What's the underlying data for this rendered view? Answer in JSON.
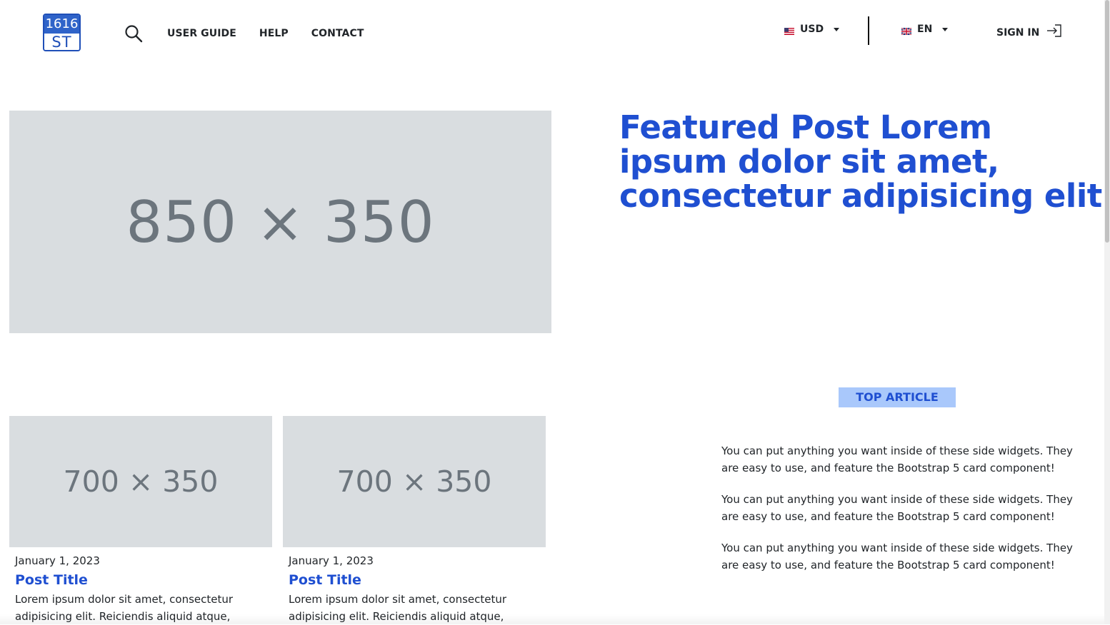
{
  "header": {
    "logo": {
      "top": "1616",
      "bottom": "ST"
    },
    "nav": [
      {
        "label": "USER GUIDE"
      },
      {
        "label": "HELP"
      },
      {
        "label": "CONTACT"
      }
    ],
    "currency": {
      "label": "USD",
      "flag": "us-flag"
    },
    "language": {
      "label": "EN",
      "flag": "uk-flag"
    },
    "signin": {
      "label": "SIGN IN"
    }
  },
  "featured": {
    "image_label": "850 × 350",
    "title": "Featured Post Lorem ipsum dolor sit amet, consectetur adipisicing elit"
  },
  "posts": [
    {
      "image_label": "700 × 350",
      "date": "January 1, 2023",
      "title": "Post Title",
      "excerpt": "Lorem ipsum dolor sit amet, consectetur adipisicing elit. Reiciendis aliquid atque,"
    },
    {
      "image_label": "700 × 350",
      "date": "January 1, 2023",
      "title": "Post Title",
      "excerpt": "Lorem ipsum dolor sit amet, consectetur adipisicing elit. Reiciendis aliquid atque,"
    }
  ],
  "sidebar": {
    "badge": "TOP ARTICLE",
    "paragraphs": [
      "You can put anything you want inside of these side widgets. They are easy to use, and feature the Bootstrap 5 card component!",
      "You can put anything you want inside of these side widgets. They are easy to use, and feature the Bootstrap 5 card component!",
      "You can put anything you want inside of these side widgets. They are easy to use, and feature the Bootstrap 5 card component!"
    ]
  },
  "colors": {
    "accent": "#1f4fd1",
    "badge_bg": "#a9c8fb",
    "placeholder_bg": "#d9dde0",
    "placeholder_text": "#6c757d"
  }
}
